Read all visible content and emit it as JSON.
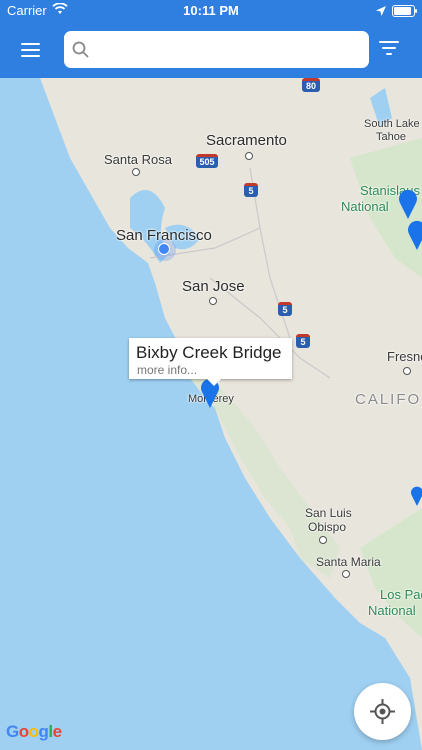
{
  "status_bar": {
    "carrier": "Carrier",
    "time": "10:11 PM"
  },
  "toolbar": {
    "search_placeholder": "",
    "search_value": ""
  },
  "icons": [
    "menu-icon",
    "search-icon",
    "filter-icon",
    "location-arrow-icon",
    "wifi-icon",
    "battery-icon",
    "map-pin-icon",
    "my-location-icon"
  ],
  "colors": {
    "toolbar": "#2f7fe0",
    "water": "#9fd0f2",
    "land": "#e9e6df",
    "pin": "#1a73e8"
  },
  "map": {
    "cities": {
      "sacramento": "Sacramento",
      "santa_rosa": "Santa Rosa",
      "san_francisco": "San Francisco",
      "san_jose": "San Jose",
      "fresno": "Fresno",
      "monterey": "Monterey",
      "san_luis_obispo_1": "San Luis",
      "san_luis_obispo_2": "Obispo",
      "santa_maria": "Santa Maria",
      "south_lake_tahoe_1": "South Lake",
      "south_lake_tahoe_2": "Tahoe"
    },
    "parks": {
      "stanislaus_1": "Stanislaus",
      "stanislaus_2": "National",
      "los_padres_1": "Los Pad",
      "los_padres_2": "National"
    },
    "region": "CALIFO",
    "shields": {
      "i505": "505",
      "i5a": "5",
      "i5b": "5",
      "i5c": "5",
      "i80": "80"
    },
    "attribution": "Google"
  },
  "callout": {
    "title": "Bixby Creek Bridge",
    "subtitle": "more info..."
  }
}
